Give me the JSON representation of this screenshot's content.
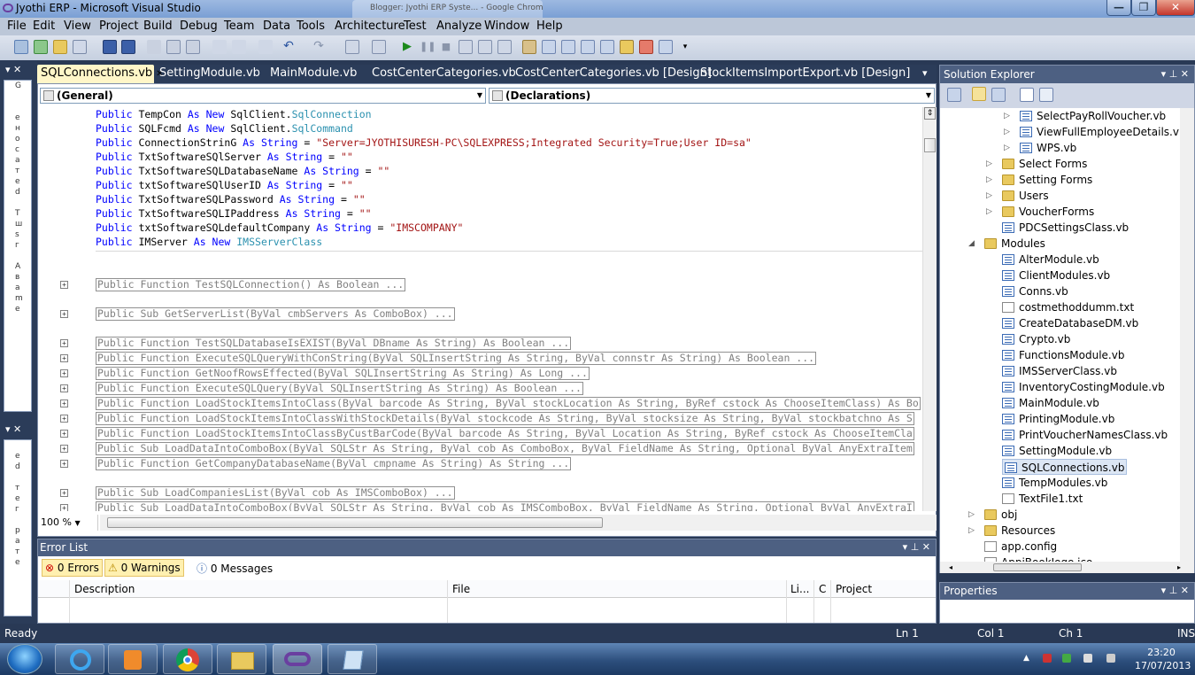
{
  "window": {
    "title": "Jyothi ERP - Microsoft Visual Studio",
    "ghost_tab": "Blogger: Jyothi ERP Syste... - Google Chrome",
    "controls": {
      "minimize": "—",
      "restore": "❐",
      "close": "✕"
    }
  },
  "menu": [
    "File",
    "Edit",
    "View",
    "Project",
    "Build",
    "Debug",
    "Team",
    "Data",
    "Tools",
    "Architecture",
    "Test",
    "Analyze",
    "Window",
    "Help"
  ],
  "doc_tabs": [
    "SQLConnections.vb",
    "SettingModule.vb",
    "MainModule.vb",
    "CostCenterCategories.vb",
    "CostCenterCategories.vb [Design]",
    "StockItemsImportExport.vb [Design]"
  ],
  "editor": {
    "class_combo": "(General)",
    "method_combo": "(Declarations)",
    "zoom": "100 %",
    "declarations": [
      [
        {
          "t": "Public ",
          "c": "kw"
        },
        {
          "t": "TempCon "
        },
        {
          "t": "As New ",
          "c": "kw"
        },
        {
          "t": "SqlClient."
        },
        {
          "t": "SqlConnection",
          "c": "ty"
        }
      ],
      [
        {
          "t": "Public ",
          "c": "kw"
        },
        {
          "t": "SQLFcmd "
        },
        {
          "t": "As New ",
          "c": "kw"
        },
        {
          "t": "SqlClient."
        },
        {
          "t": "SqlCommand",
          "c": "ty"
        }
      ],
      [
        {
          "t": "Public ",
          "c": "kw"
        },
        {
          "t": "ConnectionStrinG "
        },
        {
          "t": "As String",
          "c": "kw"
        },
        {
          "t": " = "
        },
        {
          "t": "\"Server=JYOTHISURESH-PC\\SQLEXPRESS;Integrated Security=True;User ID=sa\"",
          "c": "st"
        }
      ],
      [
        {
          "t": "Public ",
          "c": "kw"
        },
        {
          "t": "TxtSoftwareSQlServer "
        },
        {
          "t": "As String",
          "c": "kw"
        },
        {
          "t": " = "
        },
        {
          "t": "\"\"",
          "c": "st"
        }
      ],
      [
        {
          "t": "Public ",
          "c": "kw"
        },
        {
          "t": "TxtSoftwareSQLDatabaseName "
        },
        {
          "t": "As String",
          "c": "kw"
        },
        {
          "t": " = "
        },
        {
          "t": "\"\"",
          "c": "st"
        }
      ],
      [
        {
          "t": "Public ",
          "c": "kw"
        },
        {
          "t": "txtSoftwareSQlUserID "
        },
        {
          "t": "As String",
          "c": "kw"
        },
        {
          "t": " = "
        },
        {
          "t": "\"\"",
          "c": "st"
        }
      ],
      [
        {
          "t": "Public ",
          "c": "kw"
        },
        {
          "t": "TxtSoftwareSQLPassword "
        },
        {
          "t": "As String",
          "c": "kw"
        },
        {
          "t": " = "
        },
        {
          "t": "\"\"",
          "c": "st"
        }
      ],
      [
        {
          "t": "Public ",
          "c": "kw"
        },
        {
          "t": "TxtSoftwareSQLIPaddress "
        },
        {
          "t": "As String",
          "c": "kw"
        },
        {
          "t": " = "
        },
        {
          "t": "\"\"",
          "c": "st"
        }
      ],
      [
        {
          "t": "Public ",
          "c": "kw"
        },
        {
          "t": "txtSoftwareSQLdefaultCompany "
        },
        {
          "t": "As String",
          "c": "kw"
        },
        {
          "t": " = "
        },
        {
          "t": "\"IMSCOMPANY\"",
          "c": "st"
        }
      ],
      [
        {
          "t": "Public ",
          "c": "kw"
        },
        {
          "t": "IMServer "
        },
        {
          "t": "As New ",
          "c": "kw"
        },
        {
          "t": "IMSServerClass",
          "c": "ty"
        }
      ]
    ],
    "collapsed": [
      "Public Function TestSQLConnection() As Boolean ...",
      "Public Sub GetServerList(ByVal cmbServers As ComboBox) ...",
      "Public Function TestSQLDatabaseIsEXIST(ByVal DBname As String) As Boolean ...",
      "Public Function ExecuteSQLQueryWithConString(ByVal SQLInsertString As String, ByVal connstr As String) As Boolean ...",
      "Public Function GetNoofRowsEffected(ByVal SQLInsertString As String) As Long ...",
      "Public Function ExecuteSQLQuery(ByVal SQLInsertString As String) As Boolean ...",
      "Public Function LoadStockItemsIntoClass(ByVal barcode As String, ByVal stockLocation As String, ByRef cstock As ChooseItemClass) As Bo",
      "Public Function LoadStockItemsIntoClassWithStockDetails(ByVal stockcode As String, ByVal stocksize As String, ByVal stockbatchno As S",
      "Public Function LoadStockItemsIntoClassByCustBarCode(ByVal barcode As String, ByVal Location As String, ByRef cstock As ChooseItemCla",
      "Public Sub LoadDataIntoComboBox(ByVal SQLStr As String, ByVal cob As ComboBox, ByVal FieldName As String, Optional ByVal AnyExtraItem",
      "Public Function GetCompanyDatabaseName(ByVal cmpname As String) As String ...",
      "Public Sub LoadCompaniesList(ByVal cob As IMSComboBox) ...",
      "Public Sub LoadDataIntoComboBox(ByVal SQLStr As String, ByVal cob As IMSComboBox, ByVal FieldName As String, Optional ByVal AnyExtraI"
    ]
  },
  "error_list": {
    "title": "Error List",
    "errors": "0 Errors",
    "warnings": "0 Warnings",
    "messages": "0 Messages",
    "columns": [
      "Description",
      "File",
      "Li...",
      "C",
      "Project"
    ]
  },
  "solution_explorer": {
    "title": "Solution Explorer",
    "items": [
      {
        "label": "SelectPayRollVoucher.vb",
        "icon": "vb-file-icon"
      },
      {
        "label": "ViewFullEmployeeDetails.vb",
        "icon": "vb-file-icon"
      },
      {
        "label": "WPS.vb",
        "icon": "vb-file-icon"
      },
      {
        "label": "Select Forms",
        "icon": "folder-icon"
      },
      {
        "label": "Setting Forms",
        "icon": "folder-icon"
      },
      {
        "label": "Users",
        "icon": "folder-icon"
      },
      {
        "label": "VoucherForms",
        "icon": "folder-icon"
      },
      {
        "label": "PDCSettingsClass.vb",
        "icon": "vb-file-icon"
      },
      {
        "label": "Modules",
        "icon": "folder-open-icon"
      },
      {
        "label": "AlterModule.vb",
        "icon": "vb-file-icon"
      },
      {
        "label": "ClientModules.vb",
        "icon": "vb-file-icon"
      },
      {
        "label": "Conns.vb",
        "icon": "vb-file-icon"
      },
      {
        "label": "costmethoddumm.txt",
        "icon": "text-file-icon"
      },
      {
        "label": "CreateDatabaseDM.vb",
        "icon": "vb-file-icon"
      },
      {
        "label": "Crypto.vb",
        "icon": "vb-file-icon"
      },
      {
        "label": "FunctionsModule.vb",
        "icon": "vb-file-icon"
      },
      {
        "label": "IMSServerClass.vb",
        "icon": "vb-file-icon"
      },
      {
        "label": "InventoryCostingModule.vb",
        "icon": "vb-file-icon"
      },
      {
        "label": "MainModule.vb",
        "icon": "vb-file-icon"
      },
      {
        "label": "PrintingModule.vb",
        "icon": "vb-file-icon"
      },
      {
        "label": "PrintVoucherNamesClass.vb",
        "icon": "vb-file-icon"
      },
      {
        "label": "SettingModule.vb",
        "icon": "vb-file-icon"
      },
      {
        "label": "SQLConnections.vb",
        "icon": "vb-file-icon"
      },
      {
        "label": "TempModules.vb",
        "icon": "vb-file-icon"
      },
      {
        "label": "TextFile1.txt",
        "icon": "text-file-icon"
      },
      {
        "label": "obj",
        "icon": "folder-icon"
      },
      {
        "label": "Resources",
        "icon": "folder-icon"
      },
      {
        "label": "app.config",
        "icon": "config-file-icon"
      },
      {
        "label": "AppiBookIogo.ico",
        "icon": "image-file-icon"
      }
    ]
  },
  "properties": {
    "title": "Properties"
  },
  "status": {
    "ready": "Ready",
    "ln": "Ln 1",
    "col": "Col 1",
    "ch": "Ch 1",
    "ins": "INS"
  },
  "taskbar": {
    "time": "23:20",
    "date": "17/07/2013"
  }
}
